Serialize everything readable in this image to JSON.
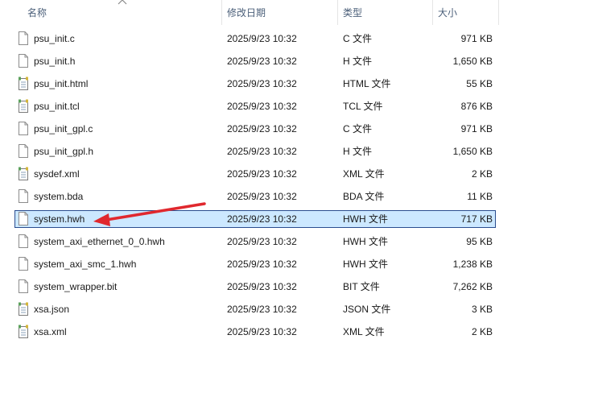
{
  "columns": {
    "name": "名称",
    "date": "修改日期",
    "type": "类型",
    "size": "大小"
  },
  "files": [
    {
      "name": "psu_init.c",
      "date": "2025/9/23 10:32",
      "type": "C 文件",
      "size": "971 KB",
      "icon": "blank-file-icon"
    },
    {
      "name": "psu_init.h",
      "date": "2025/9/23 10:32",
      "type": "H 文件",
      "size": "1,650 KB",
      "icon": "blank-file-icon"
    },
    {
      "name": "psu_init.html",
      "date": "2025/9/23 10:32",
      "type": "HTML 文件",
      "size": "55 KB",
      "icon": "notepad-file-icon"
    },
    {
      "name": "psu_init.tcl",
      "date": "2025/9/23 10:32",
      "type": "TCL 文件",
      "size": "876 KB",
      "icon": "notepad-file-icon"
    },
    {
      "name": "psu_init_gpl.c",
      "date": "2025/9/23 10:32",
      "type": "C 文件",
      "size": "971 KB",
      "icon": "blank-file-icon"
    },
    {
      "name": "psu_init_gpl.h",
      "date": "2025/9/23 10:32",
      "type": "H 文件",
      "size": "1,650 KB",
      "icon": "blank-file-icon"
    },
    {
      "name": "sysdef.xml",
      "date": "2025/9/23 10:32",
      "type": "XML 文件",
      "size": "2 KB",
      "icon": "notepad-file-icon"
    },
    {
      "name": "system.bda",
      "date": "2025/9/23 10:32",
      "type": "BDA 文件",
      "size": "11 KB",
      "icon": "blank-file-icon"
    },
    {
      "name": "system.hwh",
      "date": "2025/9/23 10:32",
      "type": "HWH 文件",
      "size": "717 KB",
      "icon": "blank-file-icon",
      "selected": true
    },
    {
      "name": "system_axi_ethernet_0_0.hwh",
      "date": "2025/9/23 10:32",
      "type": "HWH 文件",
      "size": "95 KB",
      "icon": "blank-file-icon"
    },
    {
      "name": "system_axi_smc_1.hwh",
      "date": "2025/9/23 10:32",
      "type": "HWH 文件",
      "size": "1,238 KB",
      "icon": "blank-file-icon"
    },
    {
      "name": "system_wrapper.bit",
      "date": "2025/9/23 10:32",
      "type": "BIT 文件",
      "size": "7,262 KB",
      "icon": "blank-file-icon"
    },
    {
      "name": "xsa.json",
      "date": "2025/9/23 10:32",
      "type": "JSON 文件",
      "size": "3 KB",
      "icon": "notepad-file-icon"
    },
    {
      "name": "xsa.xml",
      "date": "2025/9/23 10:32",
      "type": "XML 文件",
      "size": "2 KB",
      "icon": "notepad-file-icon"
    }
  ],
  "colors": {
    "selection_bg": "#cce8ff",
    "selection_border": "#2a4d8f",
    "header_text": "#4c607a",
    "annotation_arrow": "#e0282e"
  }
}
